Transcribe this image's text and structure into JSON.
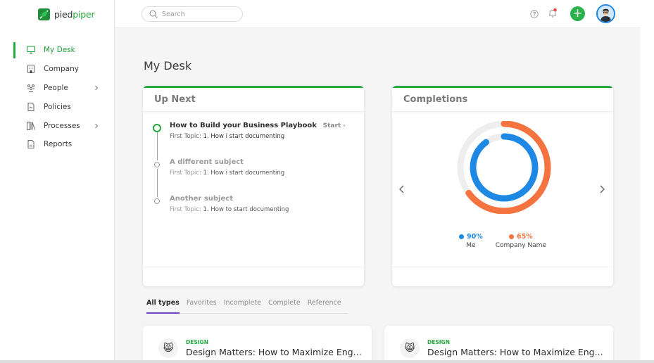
{
  "brand": {
    "name_part1": "pied",
    "name_part2": "piper",
    "accent_color": "#23a83c"
  },
  "search": {
    "placeholder": "Search"
  },
  "sidebar": {
    "items": [
      {
        "label": "My Desk",
        "icon": "desktop-icon",
        "active": true
      },
      {
        "label": "Company",
        "icon": "building-icon"
      },
      {
        "label": "People",
        "icon": "people-icon",
        "has_submenu": true
      },
      {
        "label": "Policies",
        "icon": "document-icon"
      },
      {
        "label": "Processes",
        "icon": "processes-icon",
        "has_submenu": true
      },
      {
        "label": "Reports",
        "icon": "report-icon"
      }
    ]
  },
  "page": {
    "title": "My Desk"
  },
  "up_next": {
    "title": "Up Next",
    "start_label": "Start",
    "items": [
      {
        "title": "How to Build your Business Playbook",
        "sub_label": "First Topic:",
        "sub_value": "1. How i start documenting",
        "active": true
      },
      {
        "title": "A different subject",
        "sub_label": "First Topic:",
        "sub_value": "1. How i start documenting"
      },
      {
        "title": "Another subject",
        "sub_label": "First Topic:",
        "sub_value": "1. How to start documenting"
      }
    ]
  },
  "completions": {
    "title": "Completions",
    "series": [
      {
        "name": "Me",
        "value_label": "90%",
        "value": 0.9,
        "color": "#1e88e5"
      },
      {
        "name": "Company Name",
        "value_label": "65%",
        "value": 0.65,
        "color": "#f4733f"
      }
    ]
  },
  "tabs": [
    "All types",
    "Favorites",
    "Incomplete",
    "Complete",
    "Reference"
  ],
  "courses": [
    {
      "tag": "DESIGN",
      "title": "Design Matters: How to Maximize Eng...",
      "emoji": "😸"
    },
    {
      "tag": "DESIGN",
      "title": "Design Matters: How to Maximize Eng...",
      "emoji": "😸"
    }
  ]
}
